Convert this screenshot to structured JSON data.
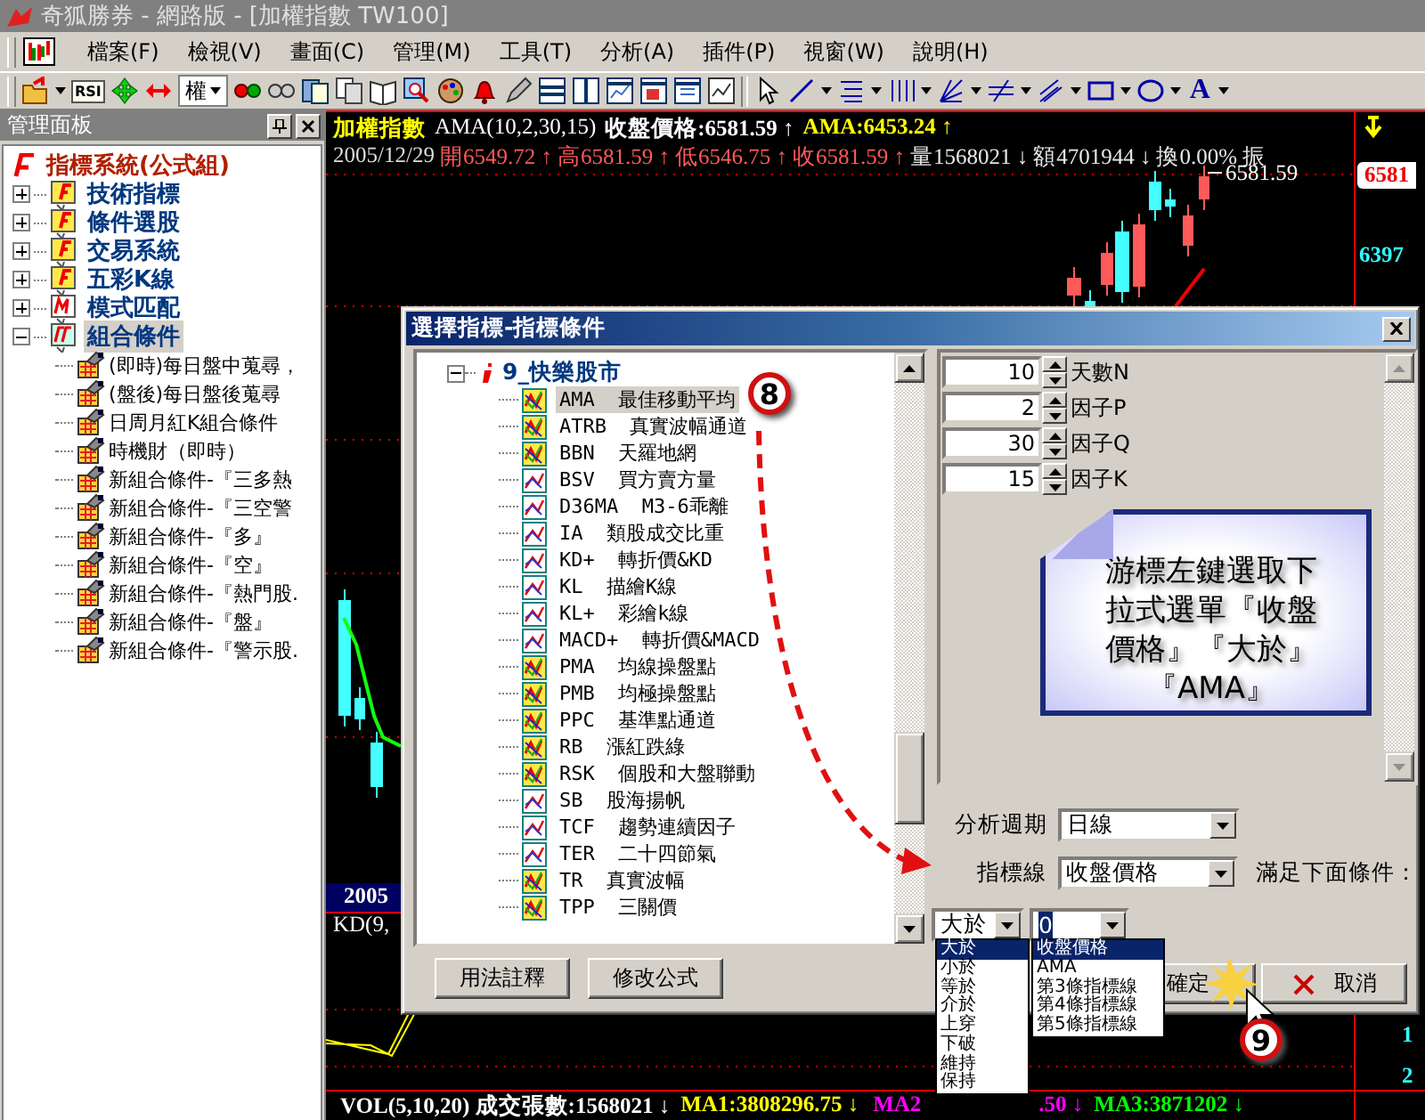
{
  "window": {
    "title": "奇狐勝券 - 網路版 - [加權指數 TW100]"
  },
  "menu": [
    "檔案(F)",
    "檢視(V)",
    "畫面(C)",
    "管理(M)",
    "工具(T)",
    "分析(A)",
    "插件(P)",
    "視窗(W)",
    "說明(H)"
  ],
  "toolbar": {
    "rsi": "RSI",
    "weight_combo": "權",
    "text_tool": "A"
  },
  "panel": {
    "title": "管理面板",
    "tree": {
      "label": "指標系統(公式組)",
      "children": [
        {
          "label": "技術指標",
          "kind": "formula",
          "expanded": false,
          "selected": false
        },
        {
          "label": "條件選股",
          "kind": "formula",
          "expanded": false,
          "selected": false
        },
        {
          "label": "交易系統",
          "kind": "formula",
          "expanded": false,
          "selected": false
        },
        {
          "label": "五彩K線",
          "kind": "formula",
          "expanded": false,
          "selected": false
        },
        {
          "label": "模式匹配",
          "kind": "pattern",
          "expanded": false,
          "selected": false
        },
        {
          "label": "組合條件",
          "kind": "combo",
          "expanded": true,
          "selected": true,
          "children": [
            {
              "label": "(即時)每日盤中蒐尋，"
            },
            {
              "label": "(盤後)每日盤後蒐尋"
            },
            {
              "label": "日周月紅K組合條件"
            },
            {
              "label": "時機財（即時）"
            },
            {
              "label": "新組合條件-『三多熱"
            },
            {
              "label": "新組合條件-『三空警"
            },
            {
              "label": "新組合條件-『多』"
            },
            {
              "label": "新組合條件-『空』"
            },
            {
              "label": "新組合條件-『熱門股."
            },
            {
              "label": "新組合條件-『盤』"
            },
            {
              "label": "新組合條件-『警示股."
            }
          ]
        }
      ]
    }
  },
  "chart": {
    "title": "加權指數",
    "indicator": "AMA(10,2,30,15)",
    "close_reading": "收盤價格:6581.59 ↑",
    "ama_reading": "AMA:6453.24 ↑",
    "date": "2005/12/29",
    "quotes": [
      {
        "text": "開6549.72 ↑",
        "kind": "price"
      },
      {
        "text": "高6581.59 ↑",
        "kind": "price"
      },
      {
        "text": "低6546.75 ↑",
        "kind": "price"
      },
      {
        "text": "收6581.59 ↑",
        "kind": "price"
      },
      {
        "text": "量1568021 ↓",
        "kind": "plain"
      },
      {
        "text": "額4701944 ↓",
        "kind": "plain"
      },
      {
        "text": "換0.00%",
        "kind": "plain"
      },
      {
        "text": "振",
        "kind": "plain"
      }
    ],
    "last_price": "6581",
    "price_tick": "6397",
    "last_price_note": "6581.59",
    "date_label": "2005",
    "kd_label": "KD(9,",
    "volume_line": [
      {
        "text": "VOL(5,10,20) 成交張數:1568021 ↓",
        "kind": "volume"
      },
      {
        "text": "MA1:3808296.75 ↓",
        "kind": "ma1"
      },
      {
        "text": "MA2",
        "kind": "ma2"
      },
      {
        "text": ".50 ↓",
        "kind": "ma2"
      },
      {
        "text": "MA3:3871202 ↓",
        "kind": "ma3"
      }
    ],
    "axis_labels": [
      "1",
      "2"
    ]
  },
  "dialog": {
    "title": "選擇指標-指標條件",
    "group": {
      "label": "9_快樂股市",
      "expanded": true,
      "items": [
        {
          "code": "AMA",
          "name": "最佳移動平均",
          "kind": "colorful",
          "selected": true
        },
        {
          "code": "ATRB",
          "name": "真實波幅通道",
          "kind": "colorful",
          "selected": false
        },
        {
          "code": "BBN",
          "name": "天羅地網",
          "kind": "colorful",
          "selected": false
        },
        {
          "code": "BSV",
          "name": "買方賣方量",
          "kind": "line",
          "selected": false
        },
        {
          "code": "D36MA",
          "name": "M3-6乖離",
          "kind": "line",
          "selected": false
        },
        {
          "code": "IA",
          "name": "類股成交比重",
          "kind": "line",
          "selected": false
        },
        {
          "code": "KD+",
          "name": "轉折價&KD",
          "kind": "line",
          "selected": false
        },
        {
          "code": "KL",
          "name": "描繪K線",
          "kind": "line",
          "selected": false
        },
        {
          "code": "KL+",
          "name": "彩繪k線",
          "kind": "line",
          "selected": false
        },
        {
          "code": "MACD+",
          "name": "轉折價&MACD",
          "kind": "line",
          "selected": false
        },
        {
          "code": "PMA",
          "name": "均線操盤點",
          "kind": "colorful",
          "selected": false
        },
        {
          "code": "PMB",
          "name": "均極操盤點",
          "kind": "colorful",
          "selected": false
        },
        {
          "code": "PPC",
          "name": "基準點通道",
          "kind": "colorful",
          "selected": false
        },
        {
          "code": "RB",
          "name": "漲紅跌綠",
          "kind": "colorful",
          "selected": false
        },
        {
          "code": "RSK",
          "name": "個股和大盤聯動",
          "kind": "colorful",
          "selected": false
        },
        {
          "code": "SB",
          "name": "股海揚帆",
          "kind": "line",
          "selected": false
        },
        {
          "code": "TCF",
          "name": "趨勢連續因子",
          "kind": "line",
          "selected": false
        },
        {
          "code": "TER",
          "name": "二十四節氣",
          "kind": "line",
          "selected": false
        },
        {
          "code": "TR",
          "name": "真實波幅",
          "kind": "colorful",
          "selected": false
        },
        {
          "code": "TPP",
          "name": "三關價",
          "kind": "colorful",
          "selected": false
        }
      ]
    },
    "params": [
      {
        "value": "10",
        "label": "天數N"
      },
      {
        "value": "2",
        "label": "因子P"
      },
      {
        "value": "30",
        "label": "因子Q"
      },
      {
        "value": "15",
        "label": "因子K"
      }
    ],
    "callout": "游標左鍵選取下拉式選單『收盤價格』『大於』『AMA』",
    "period": {
      "label": "分析週期",
      "value": "日線"
    },
    "indicator_line": {
      "label": "指標線",
      "value": "收盤價格"
    },
    "condition_label": "滿足下面條件：",
    "compare": {
      "value": "大於",
      "options": [
        {
          "label": "大於",
          "selected": true
        },
        {
          "label": "小於",
          "selected": false
        },
        {
          "label": "等於",
          "selected": false
        },
        {
          "label": "介於",
          "selected": false
        },
        {
          "label": "上穿",
          "selected": false
        },
        {
          "label": "下破",
          "selected": false
        },
        {
          "label": "維持",
          "selected": false
        },
        {
          "label": "保持",
          "selected": false
        }
      ]
    },
    "target": {
      "value": "0",
      "options": [
        {
          "label": "收盤價格",
          "selected": true
        },
        {
          "label": "AMA",
          "selected": false
        },
        {
          "label": "第3條指標線",
          "selected": false
        },
        {
          "label": "第4條指標線",
          "selected": false
        },
        {
          "label": "第5條指標線",
          "selected": false
        }
      ]
    },
    "buttons": [
      {
        "label": "用法註釋",
        "kind": "plain"
      },
      {
        "label": "修改公式",
        "kind": "plain"
      },
      {
        "label": "確定",
        "kind": "plain"
      },
      {
        "label": "取消",
        "kind": "cancel"
      }
    ]
  },
  "steps": [
    "8",
    "9"
  ]
}
